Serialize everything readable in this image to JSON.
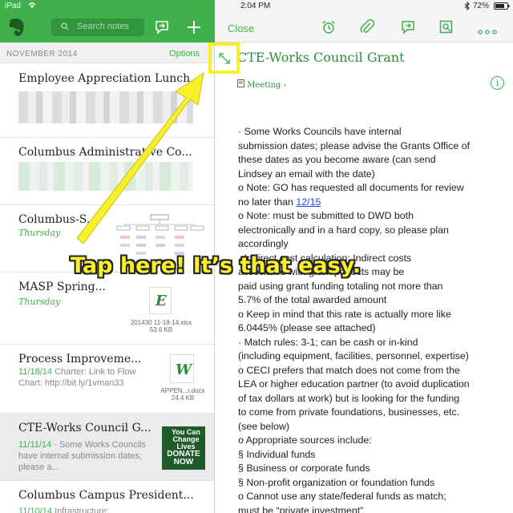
{
  "status_bar": {
    "carrier": "iPad",
    "time": "2:04 PM",
    "battery": "72%"
  },
  "sidebar": {
    "search_placeholder": "Search notes",
    "month": "NOVEMBER 2014",
    "options": "Options",
    "notes": [
      {
        "title": "Employee Appreciation Lunch"
      },
      {
        "title": "Columbus Administrative Co..."
      },
      {
        "title": "Columbus-S...",
        "date": "Thursday"
      },
      {
        "title": "MASP Spring...",
        "date": "Thursday",
        "file": "201430 11-18-14.xlsx",
        "size": "53.6 KB",
        "file_letter": "E"
      },
      {
        "title": "Process Improveme...",
        "date": "11/18/14",
        "snippet_rest": " Charter: Link to Flow Chart: http://bit.ly/1vman33",
        "file": "APPEN...r.docx",
        "size": "24.4 KB",
        "file_letter": "W"
      },
      {
        "title": "CTE-Works Council G...",
        "date": "11/11/14",
        "snippet_rest": " · Some Works Councils have internal submission dates; please a...",
        "donate_top": "You Can Change Lives",
        "donate_bottom": "DONATE NOW"
      },
      {
        "title": "Columbus Campus President...",
        "date": "11/10/14",
        "snippet_rest": " Infrastructure:"
      }
    ]
  },
  "toolbar": {
    "close_label": "Close"
  },
  "note": {
    "title": "CTE-Works Council Grant",
    "notebook": "Meeting",
    "lines": [
      "·         Some Works Councils have internal",
      "submission dates; please advise the Grants Office of",
      "these dates as you become aware (can send",
      "Lindsey an email with the date)",
      "o   Note: GO has requested all documents for review",
      "no later than ",
      "o   Note: must be submitted to DWD both",
      "electronically and in a hard copy, so please plan",
      "accordingly",
      "·         Indirect cost calculation: Indirect costs",
      "associated with grant projects may be",
      "paid using grant funding totaling not more than",
      "5.7% of the total awarded amount",
      "o   Keep in mind that this rate is actually more like",
      "6.0445% (please see attached)",
      "·         Match rules: 3-1; can be cash or in-kind",
      "(including equipment, facilities, personnel, expertise)",
      "o   CECI prefers that match does not come from the",
      "LEA or higher education partner (to avoid duplication",
      "of tax dollars at work) but is looking for the funding",
      "to come from private foundations, businesses, etc.",
      "(see below)",
      "o   Appropriate sources include:",
      "§   Individual funds",
      "§   Business or corporate funds",
      "§   Non-profit organization or foundation funds",
      "o   Cannot use any state/federal funds as match;",
      "must be “private investment”"
    ],
    "link_text": "12/15"
  },
  "annotation": {
    "callout": "Tap here! It’s that easy."
  },
  "colors": {
    "accent": "#3fb04b",
    "highlight": "#f6ef2a"
  }
}
